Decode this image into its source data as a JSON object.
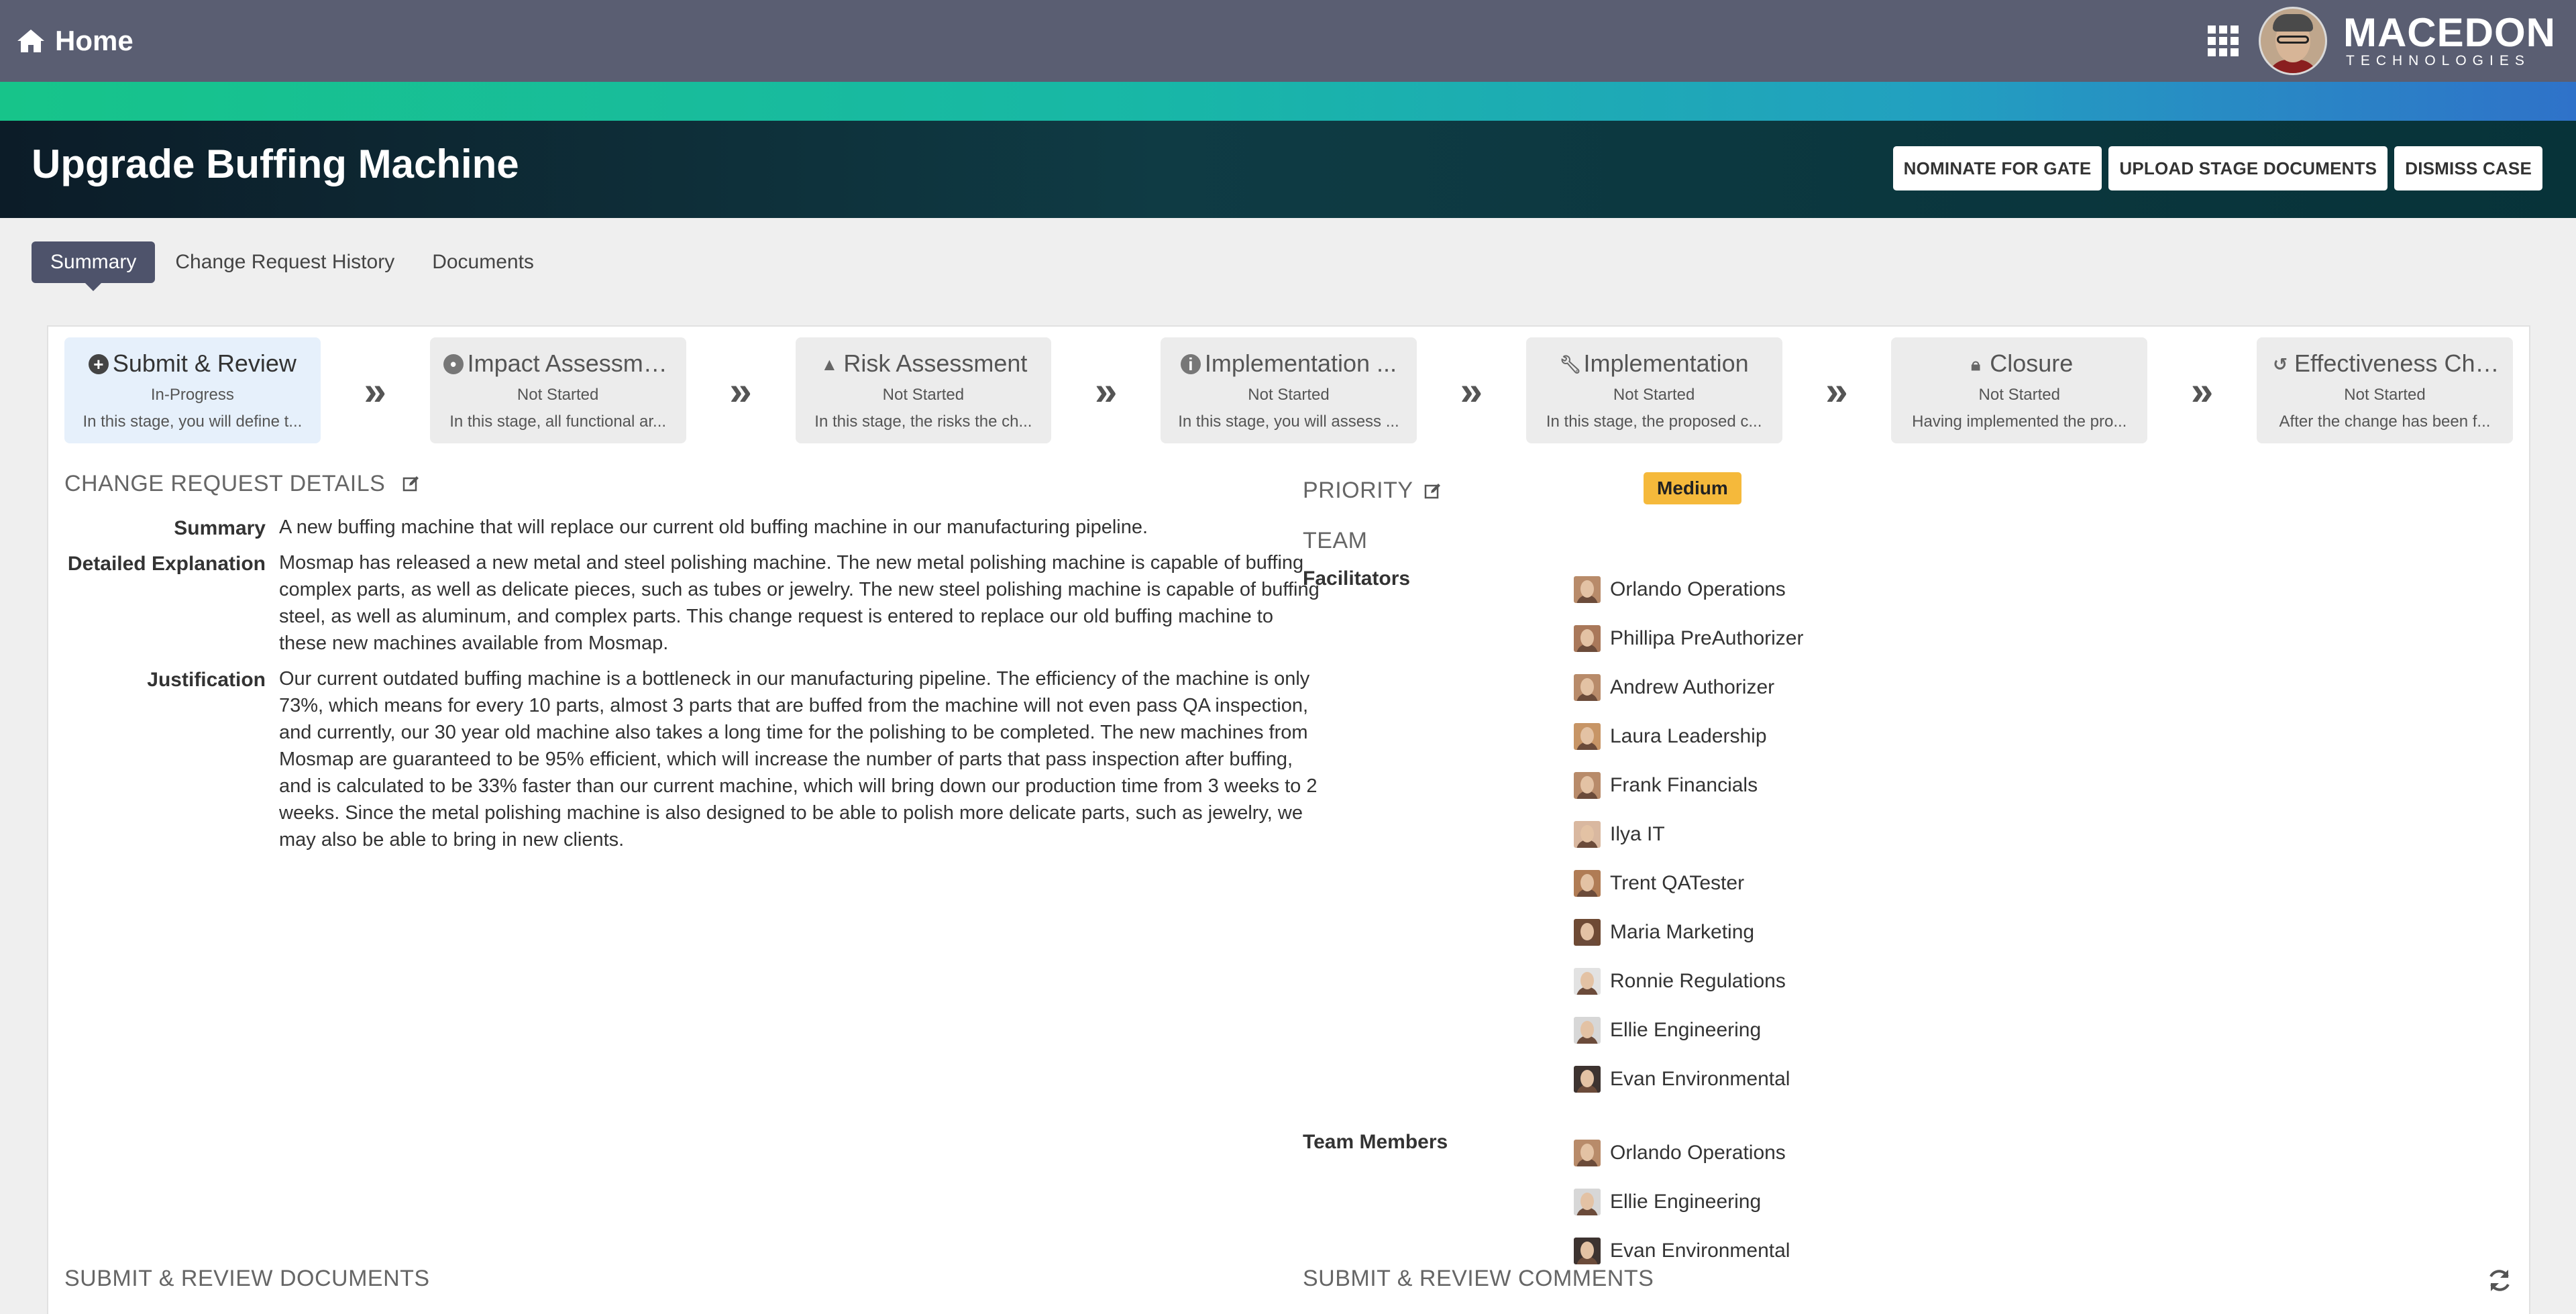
{
  "topbar": {
    "home_label": "Home",
    "brand_line1": "MACEDON",
    "brand_line2": "TECHNOLOGIES"
  },
  "header": {
    "title": "Upgrade Buffing Machine",
    "actions": [
      "NOMINATE FOR GATE",
      "UPLOAD STAGE DOCUMENTS",
      "DISMISS CASE"
    ]
  },
  "tabs": [
    "Summary",
    "Change Request History",
    "Documents"
  ],
  "stages": [
    {
      "title": "Submit & Review",
      "status": "In-Progress",
      "desc": "In this stage, you will define t...",
      "icon": "plus-circle-icon"
    },
    {
      "title": "Impact Assessme...",
      "status": "Not Started",
      "desc": "In this stage, all functional ar...",
      "icon": "dot-circle-icon"
    },
    {
      "title": "Risk Assessment",
      "status": "Not Started",
      "desc": "In this stage, the risks the ch...",
      "icon": "warning-icon"
    },
    {
      "title": "Implementation ...",
      "status": "Not Started",
      "desc": "In this stage, you will assess ...",
      "icon": "info-icon"
    },
    {
      "title": "Implementation",
      "status": "Not Started",
      "desc": "In this stage, the proposed c...",
      "icon": "wrench-icon"
    },
    {
      "title": "Closure",
      "status": "Not Started",
      "desc": "Having implemented the pro...",
      "icon": "lock-icon"
    },
    {
      "title": "Effectiveness Che...",
      "status": "Not Started",
      "desc": "After the change has been f...",
      "icon": "history-icon"
    }
  ],
  "details": {
    "section_title": "CHANGE REQUEST DETAILS",
    "summary_label": "Summary",
    "summary": "A new buffing machine that will replace our current old buffing machine in our manufacturing pipeline.",
    "explanation_label": "Detailed Explanation",
    "explanation": "Mosmap has released a new metal and steel polishing machine. The new metal polishing machine is capable of buffing complex parts, as well as delicate pieces, such as tubes or jewelry. The new steel polishing machine is capable of buffing steel, as well as aluminum, and complex parts. This change request is entered to replace our old buffing machine to these new machines available from Mosmap.",
    "justification_label": "Justification",
    "justification": "Our current outdated buffing machine is a bottleneck in our manufacturing pipeline. The efficiency of the machine is only 73%, which means for every 10 parts, almost 3 parts that are buffed from the machine will not even pass QA inspection, and currently, our 30 year old machine also takes a long time for the polishing to be completed. The new machines from Mosmap are guaranteed to be 95% efficient, which will increase the number of parts that pass inspection after buffing, and is calculated to be 33% faster than our current machine, which will bring down our production time from 3 weeks to 2 weeks. Since the metal polishing machine is also designed to be able to polish more delicate parts, such as jewelry, we may also be able to bring in new clients."
  },
  "priority": {
    "label": "PRIORITY",
    "value": "Medium",
    "badge_color": "#f5b93b"
  },
  "team": {
    "label": "TEAM",
    "facilitators_label": "Facilitators",
    "facilitators": [
      "Orlando Operations",
      "Phillipa PreAuthorizer",
      "Andrew Authorizer",
      "Laura Leadership",
      "Frank Financials",
      "Ilya IT",
      "Trent QATester",
      "Maria Marketing",
      "Ronnie Regulations",
      "Ellie Engineering",
      "Evan Environmental"
    ],
    "members_label": "Team Members",
    "members": [
      "Orlando Operations",
      "Ellie Engineering",
      "Evan Environmental"
    ]
  },
  "bottom": {
    "documents_title": "SUBMIT & REVIEW DOCUMENTS",
    "comments_title": "SUBMIT & REVIEW COMMENTS"
  }
}
